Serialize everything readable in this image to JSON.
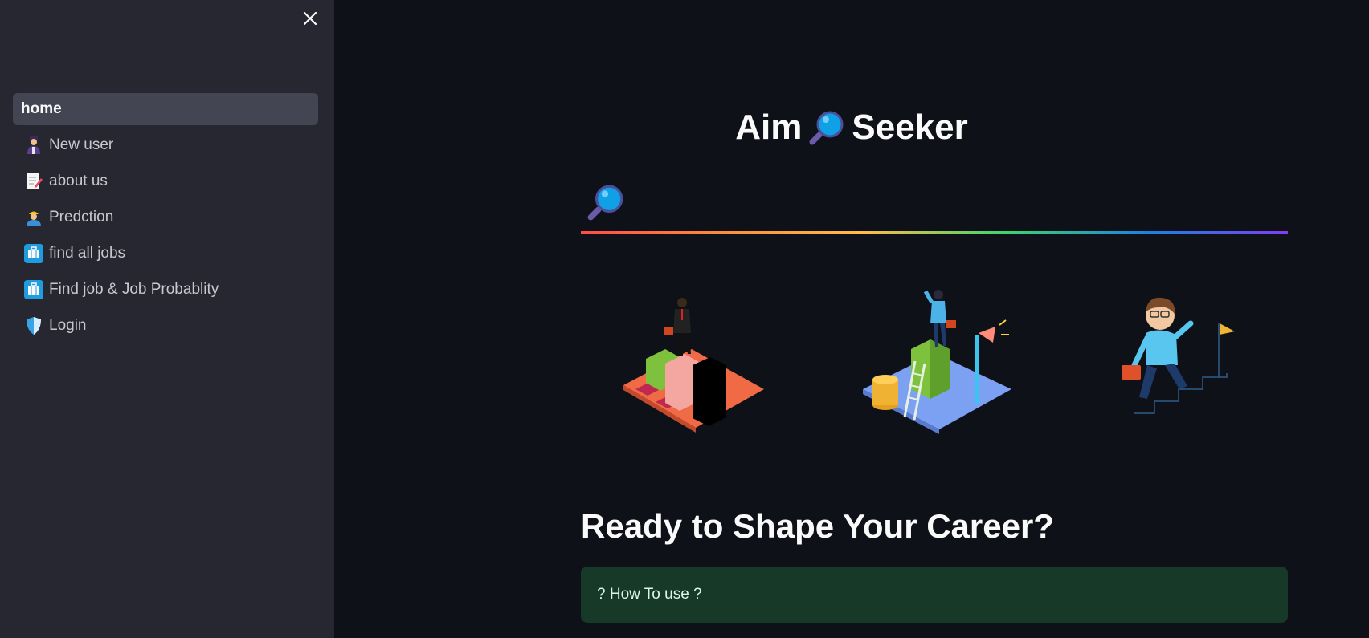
{
  "sidebar": {
    "items": [
      {
        "label": "home",
        "icon": "",
        "active": true
      },
      {
        "label": "New user",
        "icon": "person-icon"
      },
      {
        "label": "about us",
        "icon": "memo-icon"
      },
      {
        "label": "Predction",
        "icon": "worker-icon"
      },
      {
        "label": "find all jobs",
        "icon": "briefcase-icon"
      },
      {
        "label": "Find job & Job Probablity",
        "icon": "briefcase-icon"
      },
      {
        "label": "Login",
        "icon": "shield-icon"
      }
    ]
  },
  "main": {
    "title_left": "Aim",
    "title_right": "Seeker",
    "cta_heading": "Ready to Shape Your Career?",
    "howto_label": "? How To use ?"
  },
  "colors": {
    "sidebar_bg": "#262730",
    "main_bg": "#0e1117",
    "active_item_bg": "#444552",
    "info_box_bg": "#173928"
  }
}
